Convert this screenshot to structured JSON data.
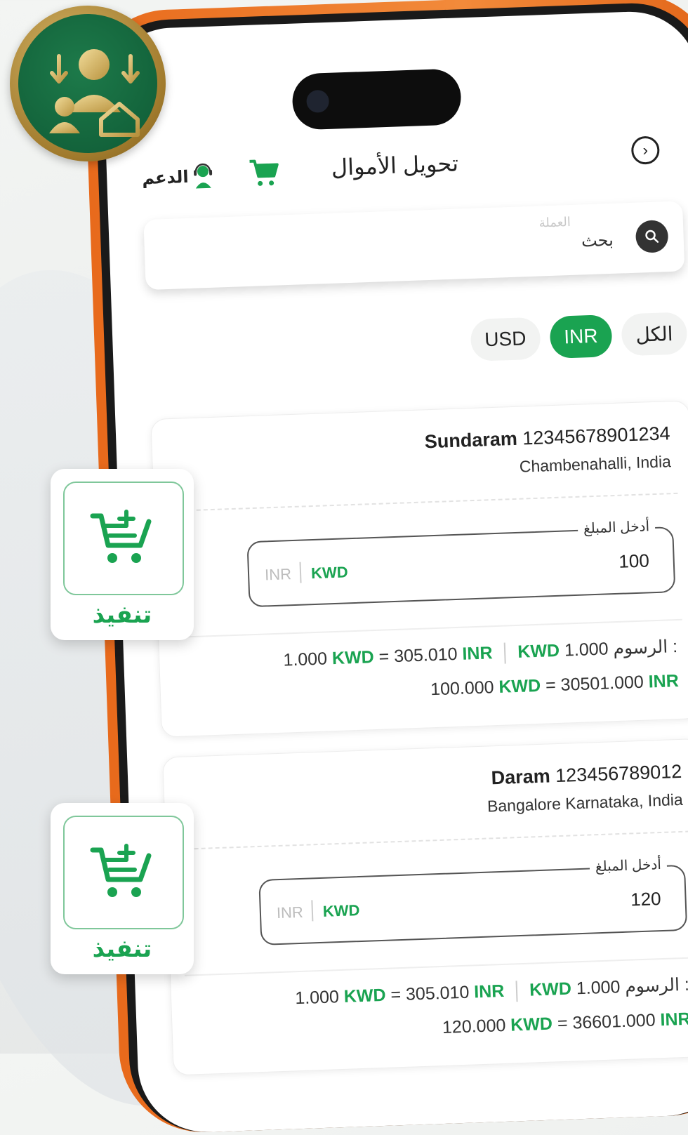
{
  "header": {
    "title": "تحويل الأموال",
    "support_label": "الدعم",
    "nav_icon": "chevron-right-icon",
    "cart_icon": "cart-icon"
  },
  "search": {
    "label": "بحث",
    "placeholder": "العملة",
    "icon": "search-icon"
  },
  "filters": {
    "chips": [
      {
        "label": "الكل",
        "active": false
      },
      {
        "label": "INR",
        "active": true
      },
      {
        "label": "USD",
        "active": false
      }
    ]
  },
  "cards": [
    {
      "name_label": "Sundaram",
      "account": "12345678901234",
      "location": "Chambenahalli, India",
      "amount_legend": "أدخل المبلغ",
      "amount_value": "100",
      "currency_from": "INR",
      "currency_to": "KWD",
      "fee_label": "الرسوم :",
      "fee_amount": "1.000",
      "fee_currency": "KWD",
      "rate_left_amount": "1.000",
      "rate_left_currency": "KWD",
      "rate_equals": "=",
      "rate_right_amount": "305.010",
      "rate_right_currency": "INR",
      "total_left_amount": "100.000",
      "total_left_currency": "KWD",
      "total_equals": "=",
      "total_right_amount": "30501.000",
      "total_right_currency": "INR",
      "execute_label": "تنفيذ"
    },
    {
      "name_label": "Daram",
      "account": "123456789012",
      "location": "Bangalore Karnataka, India",
      "amount_legend": "أدخل المبلغ",
      "amount_value": "120",
      "currency_from": "INR",
      "currency_to": "KWD",
      "fee_label": "الرسوم :",
      "fee_amount": "1.000",
      "fee_currency": "KWD",
      "rate_left_amount": "1.000",
      "rate_left_currency": "KWD",
      "rate_equals": "=",
      "rate_right_amount": "305.010",
      "rate_right_currency": "INR",
      "total_left_amount": "120.000",
      "total_left_currency": "KWD",
      "total_equals": "=",
      "total_right_amount": "36601.000",
      "total_right_currency": "INR",
      "execute_label": "تنفيذ"
    }
  ],
  "colors": {
    "accent": "#1aa351",
    "phone_frame": "#ee7a2a",
    "badge_green": "#0f5a35",
    "badge_gold": "#b8923e"
  }
}
